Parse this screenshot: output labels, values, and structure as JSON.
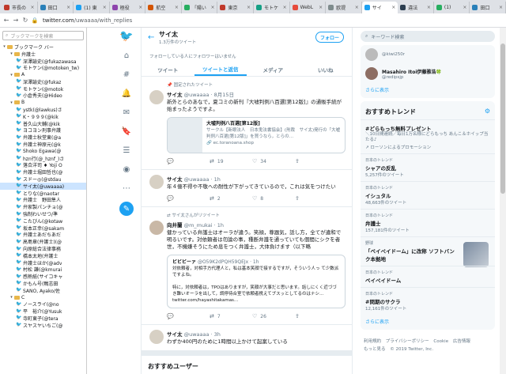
{
  "browser": {
    "tabs": [
      {
        "label": "市長の",
        "color": "#c0392b"
      },
      {
        "label": "田口",
        "color": "#2980b9"
      },
      {
        "label": "(1) 東",
        "color": "#1da1f2"
      },
      {
        "label": "極役",
        "color": "#8e44ad"
      },
      {
        "label": "航空",
        "color": "#d35400"
      },
      {
        "label": "「陽い",
        "color": "#27ae60"
      },
      {
        "label": "東京",
        "color": "#c0392b"
      },
      {
        "label": "モトケ",
        "color": "#16a085"
      },
      {
        "label": "WebL",
        "color": "#e74c3c"
      },
      {
        "label": "欧提",
        "color": "#7f8c8d"
      },
      {
        "label": "サイ",
        "color": "#1da1f2",
        "active": true
      },
      {
        "label": "違法",
        "color": "#2c3e50"
      },
      {
        "label": "(1)",
        "color": "#27ae60"
      },
      {
        "label": "田口",
        "color": "#2980b9"
      }
    ],
    "url_domain": "twitter.com",
    "url_path": "/uwaaaa/with_replies"
  },
  "bookmarks": {
    "search_placeholder": "ブックマークを検索",
    "items": [
      {
        "depth": 0,
        "type": "folder",
        "open": true,
        "label": "ブックマーク バー"
      },
      {
        "depth": 1,
        "type": "folder",
        "open": true,
        "label": "弁護士"
      },
      {
        "depth": 2,
        "type": "link",
        "label": "深澤諭史(@fukazawasa"
      },
      {
        "depth": 2,
        "type": "link",
        "label": "モトケン(@motoken_tw)"
      },
      {
        "depth": 1,
        "type": "folder",
        "open": true,
        "label": "A"
      },
      {
        "depth": 2,
        "type": "link",
        "label": "深澤諭史(@fukaz"
      },
      {
        "depth": 2,
        "type": "link",
        "label": "モトケン(@motok"
      },
      {
        "depth": 2,
        "type": "link",
        "label": "小倉秀夫(@Hideo"
      },
      {
        "depth": 1,
        "type": "folder",
        "open": true,
        "label": "B"
      },
      {
        "depth": 2,
        "type": "link",
        "label": "ystk(@lawkus)さ"
      },
      {
        "depth": 2,
        "type": "link",
        "label": "K・９９９(@kik"
      },
      {
        "depth": 2,
        "type": "link",
        "label": "普久山大輔(@kik"
      },
      {
        "depth": 2,
        "type": "link",
        "label": "ヨコヨン刑事弁護"
      },
      {
        "depth": 2,
        "type": "link",
        "label": "弁護士秋堂東(@a"
      },
      {
        "depth": 2,
        "type": "link",
        "label": "弁護士神原元(@k"
      },
      {
        "depth": 2,
        "type": "link",
        "label": "Shoko Egawa(@"
      },
      {
        "depth": 2,
        "type": "link",
        "label": "hzn行(@_hznf_)さ"
      },
      {
        "depth": 2,
        "type": "link",
        "label": "落合洋司 ♦ Yoji O"
      },
      {
        "depth": 2,
        "type": "link",
        "label": "弁護士堀田哲也(@"
      },
      {
        "depth": 2,
        "type": "link",
        "label": "スドー◎(@stdau"
      },
      {
        "depth": 2,
        "type": "link",
        "label": "サイ太(@uwaaaa)",
        "selected": true
      },
      {
        "depth": 2,
        "type": "link",
        "label": "とりな(@naotar"
      },
      {
        "depth": 2,
        "type": "link",
        "label": "弁護士　野田隼人"
      },
      {
        "depth": 2,
        "type": "link",
        "label": "弁家製パンチョ(@"
      },
      {
        "depth": 2,
        "type": "link",
        "label": "強制わいせつ/準"
      },
      {
        "depth": 2,
        "type": "link",
        "label": "こたびん(@kotaw"
      },
      {
        "depth": 2,
        "type": "link",
        "label": "坂本正幸(@sakam"
      },
      {
        "depth": 2,
        "type": "link",
        "label": "弁護士あだちあだ"
      },
      {
        "depth": 2,
        "type": "link",
        "label": "高島章(弁護士)(@"
      },
      {
        "depth": 2,
        "type": "link",
        "label": "向原総合法律事務"
      },
      {
        "depth": 2,
        "type": "link",
        "label": "橋本太地(弁護士"
      },
      {
        "depth": 2,
        "type": "link",
        "label": "弁護士ほか(@adv"
      },
      {
        "depth": 2,
        "type": "link",
        "label": "村松 謙(@kmurai"
      },
      {
        "depth": 2,
        "type": "link",
        "label": "感熱紙(サイコキャ"
      },
      {
        "depth": 2,
        "type": "link",
        "label": "かもん号(鴨志田"
      },
      {
        "depth": 2,
        "type": "link",
        "label": "SANO, Ayako/佐"
      },
      {
        "depth": 1,
        "type": "folder",
        "open": true,
        "label": "C"
      },
      {
        "depth": 2,
        "type": "link",
        "label": "ノースライ(@no"
      },
      {
        "depth": 2,
        "type": "link",
        "label": "平　裕介(@Yusuk"
      },
      {
        "depth": 2,
        "type": "link",
        "label": "寺町東子(@tera"
      },
      {
        "depth": 2,
        "type": "link",
        "label": "スヤスヤいちご(@"
      }
    ]
  },
  "profile": {
    "name": "サイ太",
    "tweet_count": "1.3万件のツイート",
    "follow_label": "フォロー",
    "follow_note": "フォローしている人にフォロワーはいません",
    "tabs": [
      "ツイート",
      "ツイートと返信",
      "メディア",
      "いいね"
    ]
  },
  "tweets": [
    {
      "context": "固定されたツイート",
      "name": "サイ太",
      "handle": "@uwaaaa",
      "time": "8月15日",
      "text": "新外とらのあなで，夏コミの新刊『大嘘判例八百選[第12版]』の通販手続が始まったようですよ。",
      "card": {
        "title": "大嘘判例八百選[第12版]",
        "desc": "サークル【新眼法人　日本鬼法書協会】(刑裁　サイ太)発行の「大嘘判例八百選[第12版]」を買うなら，とらの…",
        "link": "ec.toranoana.shop"
      },
      "replies": "",
      "retweets": "19",
      "likes": "34"
    },
    {
      "context": "",
      "name": "サイ太",
      "handle": "@uwaaaa",
      "time": "1h",
      "text": "年４億不得や不敬への耐性が下がってきているので，これは気をつけたい",
      "replies": "",
      "retweets": "2",
      "likes": "8"
    },
    {
      "context": "サイ太さんがリツイート",
      "name": "向井蘭",
      "handle": "@m_mukai",
      "time": "1h",
      "text": "健かっている弁護士はオーラが違う。笑顔，尊器気，話し方，全てが違和で明るいです。対依頼者は勿論の事，種断弁護を通っていても個間にシクを者世，不機嫌そうにため息をつく弁護士，大体負けます（以下略",
      "quote": {
        "name": "ビビビーァ",
        "handle": "@O59K2dPQH59QEJx",
        "time": "1h",
        "text": "対依頼者，対相手方代理人と，私は基本笑顔で接するですが，そういう人っ て少数派ですよね。\n\n特に，対依頼者は，TPOはありますが，笑顔が大事だと思います。話しにくく近づづき難いオーラを出して，調停待合室で依頼者携えてブスッとしてるのはナシ…",
        "link": "twitter.com/hayashitakamas…"
      },
      "replies": "",
      "retweets": "7",
      "likes": "26"
    },
    {
      "context": "",
      "name": "サイ太",
      "handle": "@uwaaaa",
      "time": "3h",
      "text": "わずか400円のために1時間以上かけて起案している",
      "replies": "",
      "retweets": "",
      "likes": ""
    }
  ],
  "suggestions_title": "おすすめユーザー",
  "sidebar": {
    "search_placeholder": "キーワード検索",
    "who_to_follow": [
      {
        "name": "",
        "handle": "@kiwi250r"
      },
      {
        "name": "Masahiro Itoi伊藤雅浩🍀",
        "handle": "@redipsjp"
      }
    ],
    "more_label": "さらに表示",
    "trends_title": "おすすめトレンド",
    "trends": [
      {
        "category": "",
        "name": "#どらもっち無料プレゼント",
        "desc": "＼10日間連続／毎日1万名様にどらもっち あんこ＆ホイップ当たる♪",
        "count": "",
        "promo": "ローソンによるプロモーション"
      },
      {
        "category": "日本のトレンド",
        "name": "シャアの反乱",
        "desc": "",
        "count": "5,257件のツイート",
        "promo": ""
      },
      {
        "category": "日本のトレンド",
        "name": "イシュタル",
        "desc": "",
        "count": "48,663件のツイート",
        "promo": ""
      },
      {
        "category": "日本のトレンド",
        "name": "弁護士",
        "desc": "",
        "count": "157,181件のツイート",
        "promo": ""
      },
      {
        "category": "野球",
        "name": "「ベイペイドーム」に改称 ソフトバンク本拠地",
        "desc": "",
        "count": "",
        "promo": "",
        "thumb": true
      },
      {
        "category": "日本のトレンド",
        "name": "ベイペイドーム",
        "desc": "",
        "count": "",
        "promo": ""
      },
      {
        "category": "日本のトレンド",
        "name": "#問期のサクラ",
        "desc": "",
        "count": "12,161件のツイート",
        "promo": ""
      }
    ],
    "trends_more": "さらに表示",
    "footer": [
      "利用規約",
      "プライバシーポリシー",
      "Cookie",
      "広告情報",
      "もっと見る",
      "© 2019 Twitter, Inc."
    ]
  }
}
